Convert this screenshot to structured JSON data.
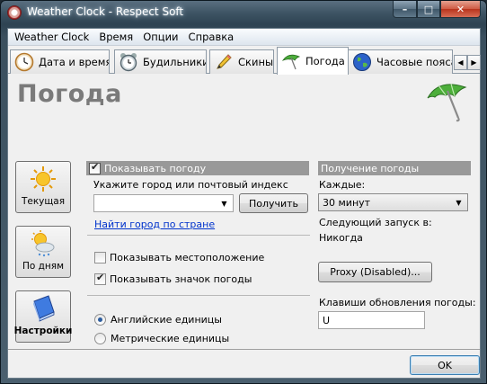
{
  "window": {
    "title": "Weather Clock - Respect Soft",
    "controls": {
      "minimize": "–",
      "maximize": "□",
      "close": "✕"
    }
  },
  "menu": [
    "Weather Clock",
    "Время",
    "Опции",
    "Справка"
  ],
  "tabs": [
    {
      "label": "Дата и время",
      "icon": "clock-icon"
    },
    {
      "label": "Будильники",
      "icon": "alarm-clock-icon"
    },
    {
      "label": "Скины",
      "icon": "pencil-icon"
    },
    {
      "label": "Погода",
      "icon": "umbrella-icon",
      "active": true
    },
    {
      "label": "Часовые пояса",
      "icon": "globe-icon"
    }
  ],
  "tab_scroll": {
    "left": "◀",
    "right": "▶"
  },
  "page": {
    "title": "Погода",
    "side_buttons": [
      {
        "label": "Текущая",
        "icon": "sun-icon"
      },
      {
        "label": "По дням",
        "icon": "sun-cloud-icon"
      },
      {
        "label": "Настройки",
        "icon": "settings-book-icon",
        "active": true
      }
    ],
    "weather": {
      "show_weather_label": "Показывать погоду",
      "show_weather_checked": true,
      "city_prompt": "Укажите город или почтовый индекс",
      "city_value": "",
      "get_button": "Получить",
      "find_link": "Найти город по стране",
      "show_location_label": "Показывать местоположение",
      "show_location_checked": false,
      "show_icon_label": "Показывать значок погоды",
      "show_icon_checked": true,
      "units": [
        {
          "label": "Английские единицы",
          "selected": true
        },
        {
          "label": "Метрические единицы",
          "selected": false
        }
      ]
    },
    "fetch": {
      "header": "Получение погоды",
      "every_label": "Каждые:",
      "every_value": "30 минут",
      "next_run_label": "Следующий запуск в:",
      "next_run_value": "Никогда",
      "proxy_button": "Proxy (Disabled)...",
      "hotkey_label": "Клавиши обновления погоды:",
      "hotkey_value": "U"
    }
  },
  "footer": {
    "ok_button": "OK"
  },
  "colors": {
    "section_header": "#999999",
    "title_gray": "#7a7a7a",
    "link": "#0033cc",
    "close_red": "#c9412a",
    "umbrella_green": "#4cae3a"
  }
}
